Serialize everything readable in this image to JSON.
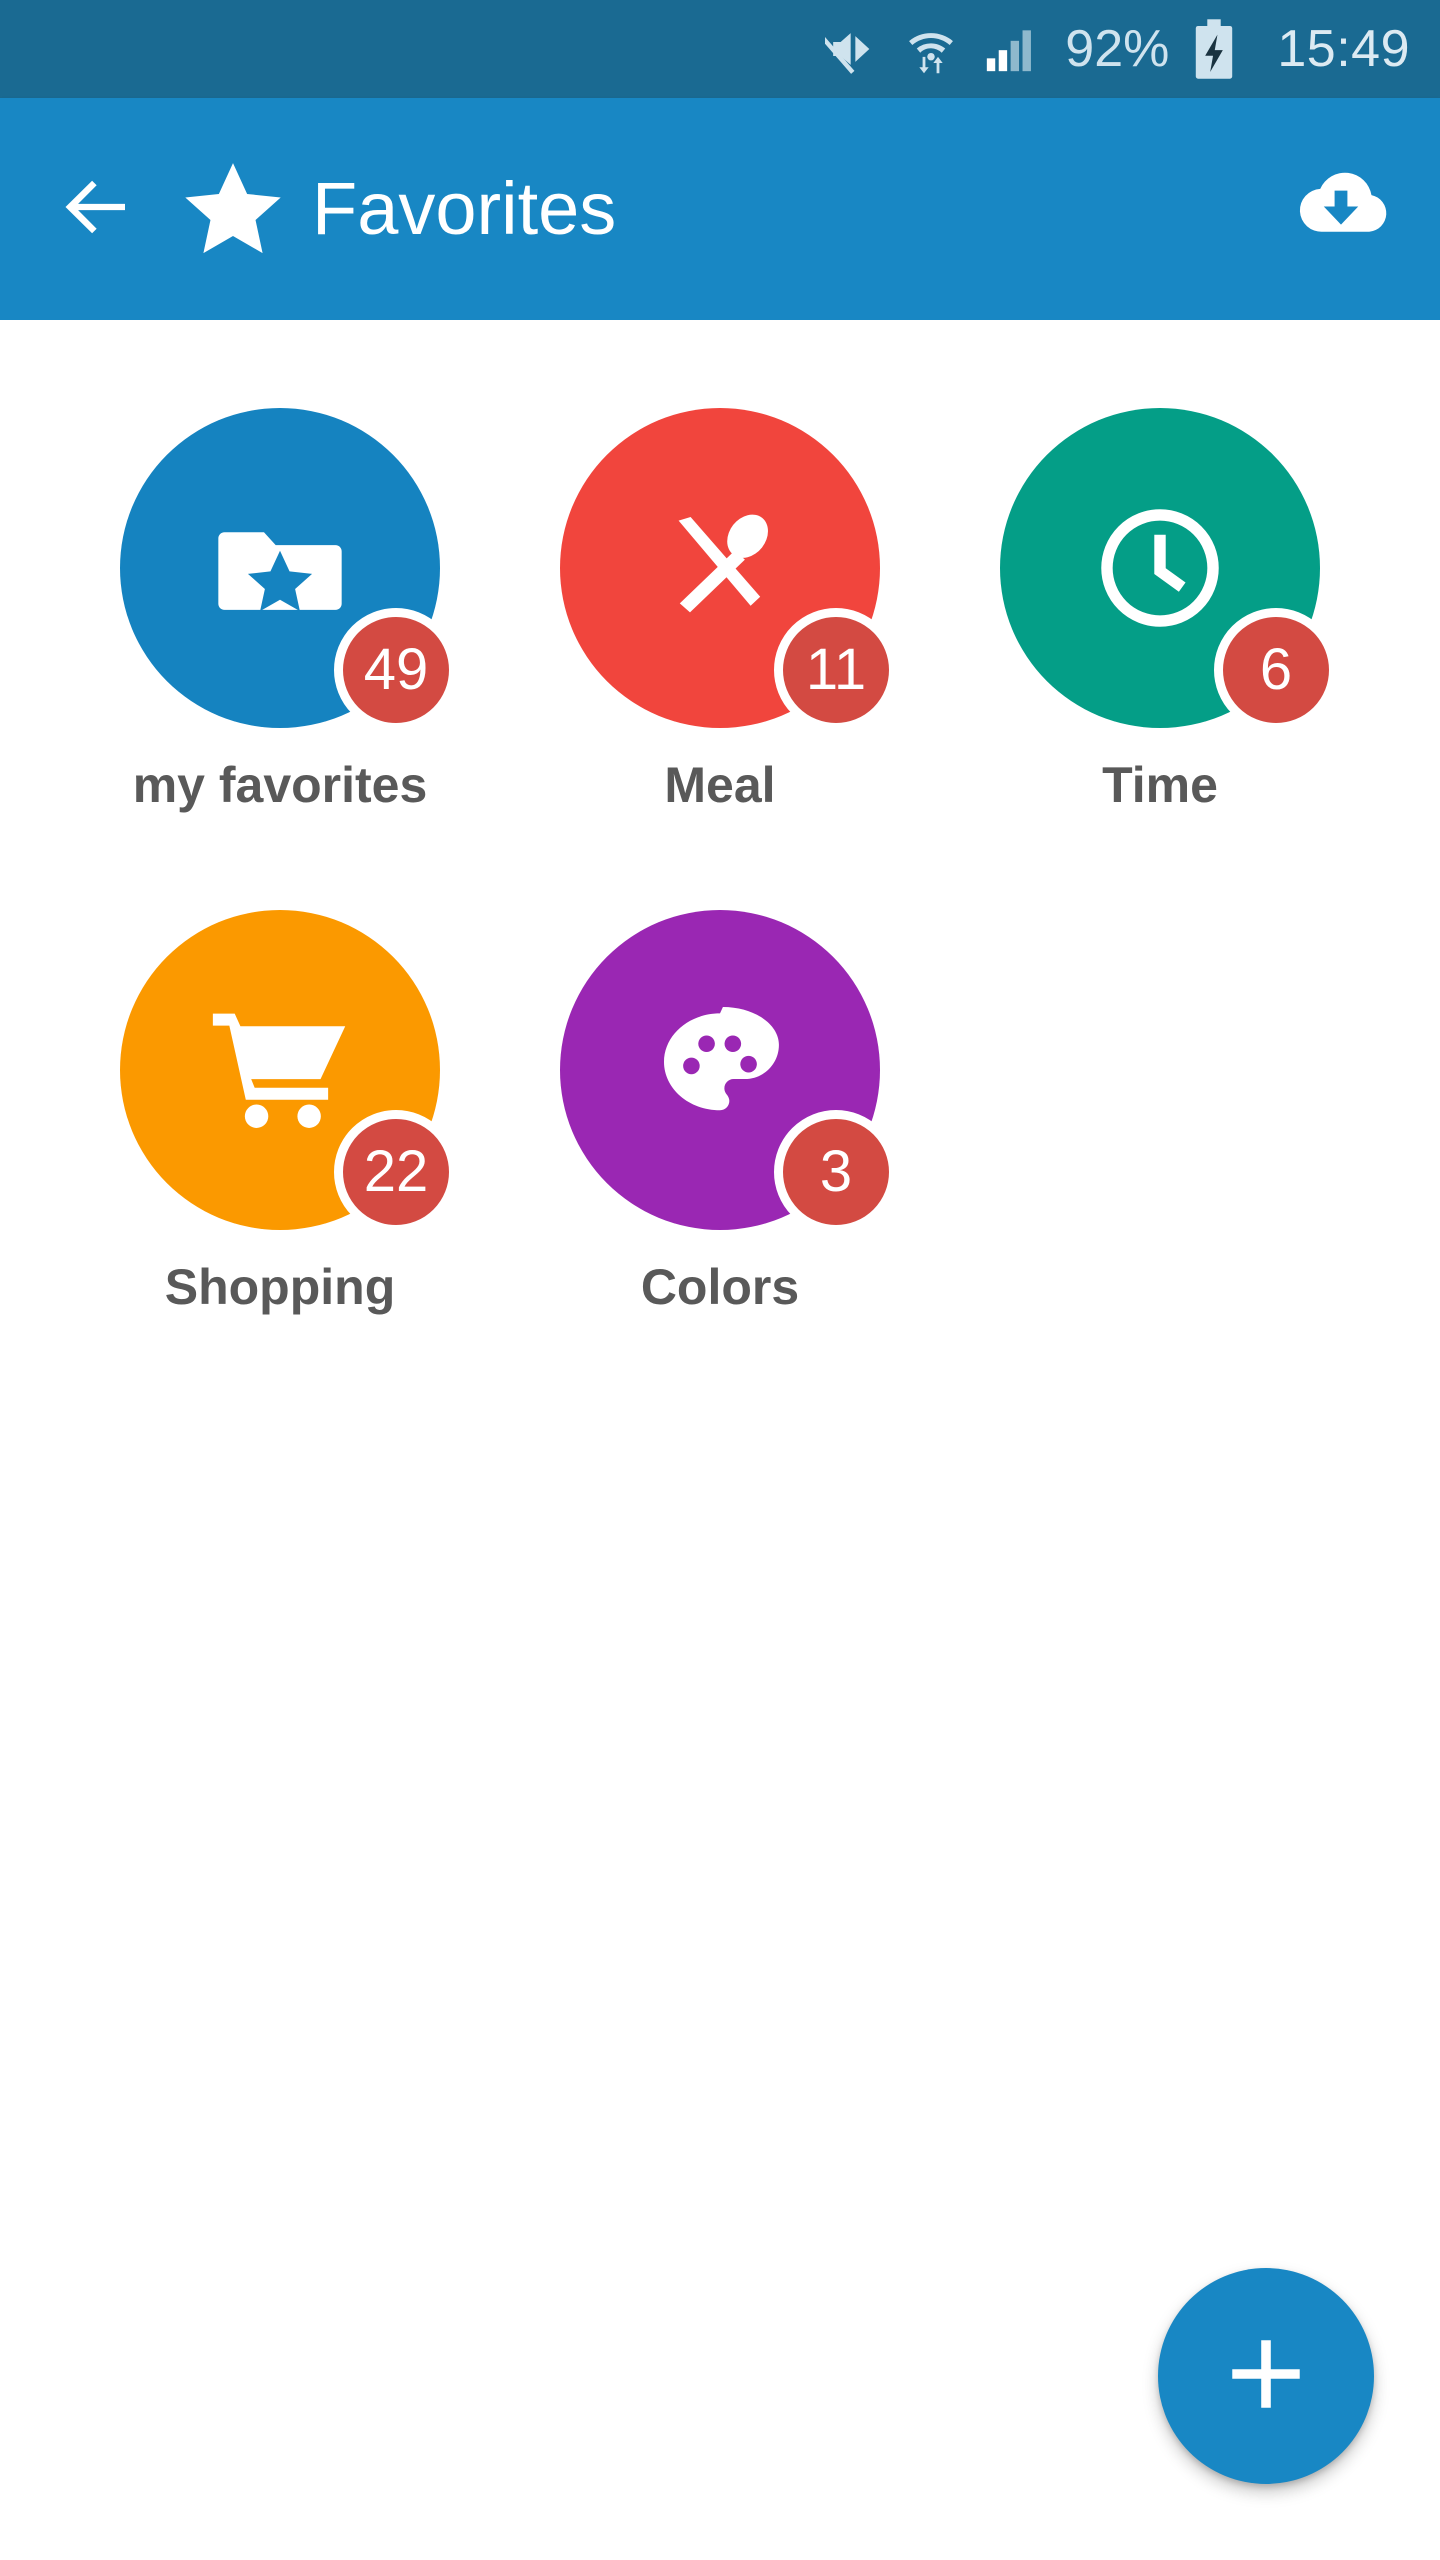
{
  "status_bar": {
    "background": "#1A6A92",
    "battery_percent": "92%",
    "clock": "15:49",
    "icons": [
      "mute-icon",
      "wifi-transfer-icon",
      "signal-bars-icon",
      "battery-charging-icon"
    ]
  },
  "app_bar": {
    "background": "#1887C4",
    "title": "Favorites",
    "back_icon": "arrow-left-icon",
    "title_icon": "star-icon",
    "action_icon": "cloud-download-icon"
  },
  "grid": {
    "items": [
      {
        "label": "my favorites",
        "badge": "49",
        "color": "#1583C0",
        "icon": "folder-star-icon"
      },
      {
        "label": "Meal",
        "badge": "11",
        "color": "#F1453D",
        "icon": "cutlery-icon"
      },
      {
        "label": "Time",
        "badge": "6",
        "color": "#049E87",
        "icon": "clock-icon"
      },
      {
        "label": "Shopping",
        "badge": "22",
        "color": "#FB9900",
        "icon": "shopping-cart-icon"
      },
      {
        "label": "Colors",
        "badge": "3",
        "color": "#9A27B3",
        "icon": "palette-icon"
      }
    ],
    "badge_color": "#D34A42",
    "label_color": "#595959"
  },
  "fab": {
    "icon": "plus-icon",
    "color": "#1887C4"
  }
}
